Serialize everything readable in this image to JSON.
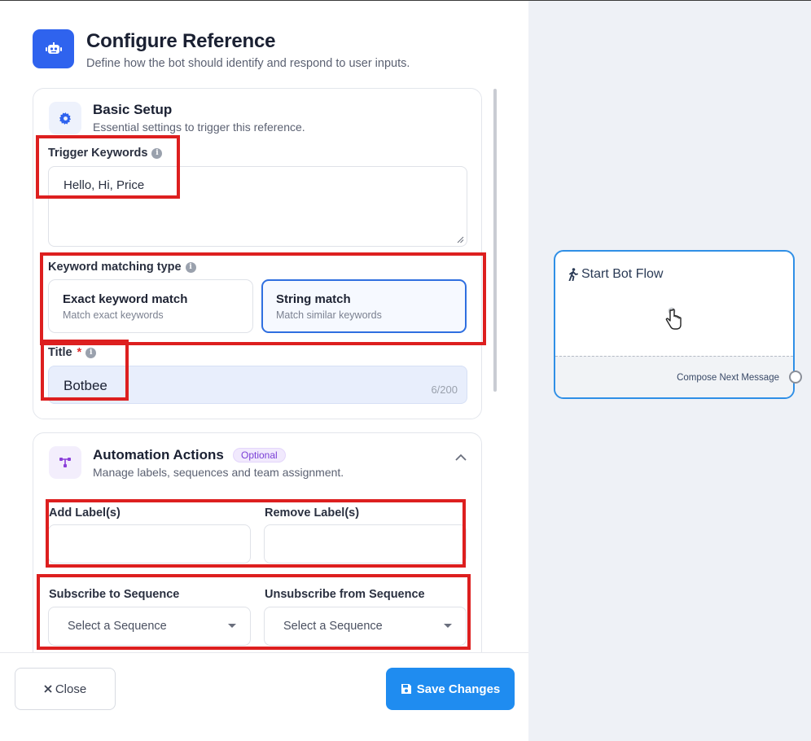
{
  "header": {
    "title": "Configure Reference",
    "subtitle": "Define how the bot should identify and respond to user inputs.",
    "icon": "robot-icon"
  },
  "basic_setup": {
    "title": "Basic Setup",
    "subtitle": "Essential settings to trigger this reference.",
    "icon": "gear-icon",
    "trigger_keywords_label": "Trigger Keywords",
    "trigger_keywords_value": "Hello, Hi, Price",
    "matching_type_label": "Keyword matching type",
    "options": [
      {
        "title": "Exact keyword match",
        "description": "Match exact keywords",
        "selected": false
      },
      {
        "title": "String match",
        "description": "Match similar keywords",
        "selected": true
      }
    ],
    "title_label": "Title",
    "required_mark": "*",
    "title_value": "Botbee",
    "title_counter": "6/200"
  },
  "automation": {
    "title": "Automation Actions",
    "badge": "Optional",
    "subtitle": "Manage labels, sequences and team assignment.",
    "icon": "flow-icon",
    "add_label": "Add Label(s)",
    "remove_label": "Remove Label(s)",
    "subscribe_label": "Subscribe to Sequence",
    "unsubscribe_label": "Unsubscribe from Sequence",
    "subscribe_value": "Select a Sequence",
    "unsubscribe_value": "Select a Sequence"
  },
  "footer": {
    "close_label": "Close",
    "save_label": "Save Changes"
  },
  "node": {
    "title": "Start Bot Flow",
    "footer_text": "Compose Next Message"
  },
  "colors": {
    "primary": "#2f63ee",
    "save_button": "#1f8cf0",
    "highlight": "#dd1f1f",
    "node_border": "#2f8fe6"
  }
}
